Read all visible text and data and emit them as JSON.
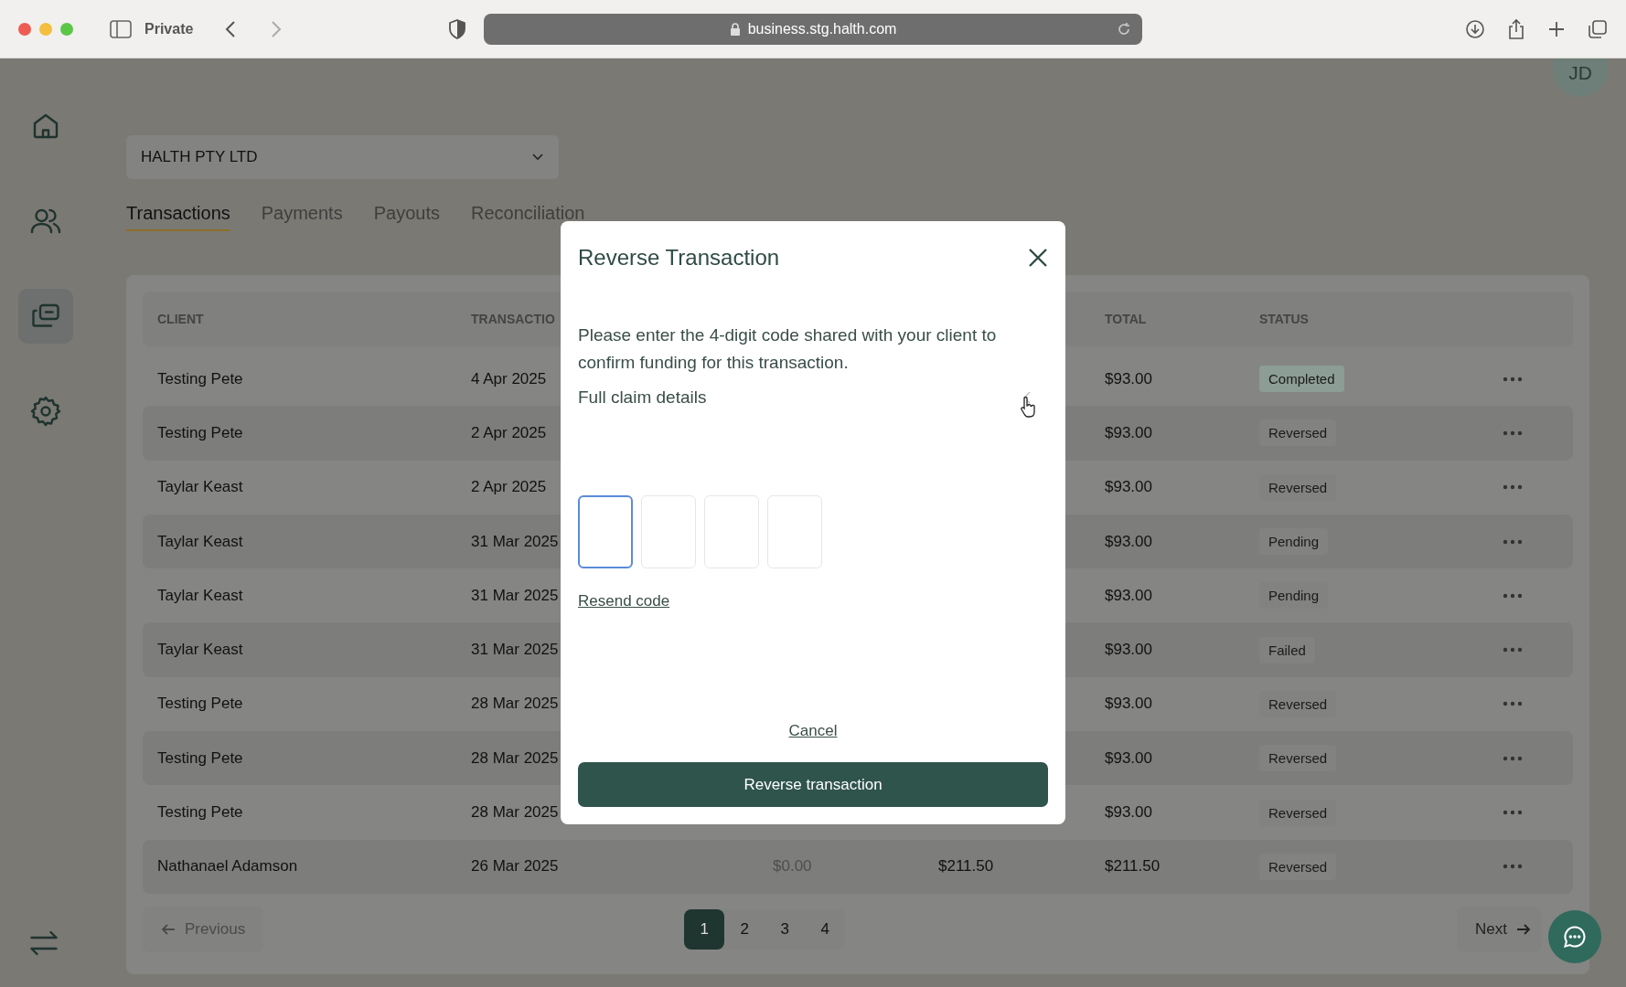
{
  "browser": {
    "private_label": "Private",
    "address": "business.stg.halth.com"
  },
  "avatar": {
    "initials": "JD"
  },
  "sidebar": {
    "items": [
      {
        "kind": "home",
        "selected": false
      },
      {
        "kind": "clients",
        "selected": false
      },
      {
        "kind": "transactions",
        "selected": true
      },
      {
        "kind": "settings",
        "selected": false
      }
    ]
  },
  "business_select": {
    "value": "HALTH PTY LTD"
  },
  "tabs": [
    {
      "label": "Transactions",
      "selected": true
    },
    {
      "label": "Payments",
      "selected": false
    },
    {
      "label": "Payouts",
      "selected": false
    },
    {
      "label": "Reconciliation",
      "selected": false
    }
  ],
  "table": {
    "columns": [
      "CLIENT",
      "TRANSACTIO",
      "TOTAL",
      "STATUS"
    ],
    "rows": [
      {
        "client": "Testing Pete",
        "date": "4 Apr 2025",
        "total": "$93.00",
        "status": "Completed",
        "color": "#8c9d95"
      },
      {
        "client": "Testing Pete",
        "date": "2 Apr 2025",
        "total": "$93.00",
        "status": "Reversed",
        "color": "#828281"
      },
      {
        "client": "Taylar Keast",
        "date": "2 Apr 2025",
        "total": "$93.00",
        "status": "Reversed",
        "color": "#828281"
      },
      {
        "client": "Taylar Keast",
        "date": "31 Mar 2025",
        "total": "$93.00",
        "status": "Pending",
        "color": "#828281"
      },
      {
        "client": "Taylar Keast",
        "date": "31 Mar 2025",
        "total": "$93.00",
        "status": "Pending",
        "color": "#828281"
      },
      {
        "client": "Taylar Keast",
        "date": "31 Mar 2025",
        "total": "$93.00",
        "status": "Failed",
        "color": "#828281"
      },
      {
        "client": "Testing Pete",
        "date": "28 Mar 2025",
        "total": "$93.00",
        "status": "Reversed",
        "color": "#828281"
      },
      {
        "client": "Testing Pete",
        "date": "28 Mar 2025",
        "total": "$93.00",
        "status": "Reversed",
        "color": "#828281"
      },
      {
        "client": "Testing Pete",
        "date": "28 Mar 2025",
        "total": "$93.00",
        "status": "Reversed",
        "color": "#828281"
      },
      {
        "client": "Nathanael Adamson",
        "date": "26 Mar 2025",
        "column_3": "$0.00",
        "column_4": "$211.50",
        "total": "$211.50",
        "status": "Reversed",
        "color": "#828281"
      }
    ]
  },
  "pagination": {
    "previous": "Previous",
    "next": "Next",
    "pages": [
      {
        "label": "1",
        "selected": true
      },
      {
        "label": "2",
        "selected": false
      },
      {
        "label": "3",
        "selected": false
      },
      {
        "label": "4",
        "selected": false
      }
    ]
  },
  "modal": {
    "title": "Reverse Transaction",
    "message": "Please enter the 4-digit code shared with your client to confirm funding for this transaction.",
    "details_label": "Full claim details",
    "details_expanded": false,
    "code_digits": [
      {
        "focused": true
      },
      {
        "focused": false
      },
      {
        "focused": false
      },
      {
        "focused": false
      }
    ],
    "resend": "Resend code",
    "cancel": "Cancel",
    "confirm": "Reverse transaction"
  }
}
